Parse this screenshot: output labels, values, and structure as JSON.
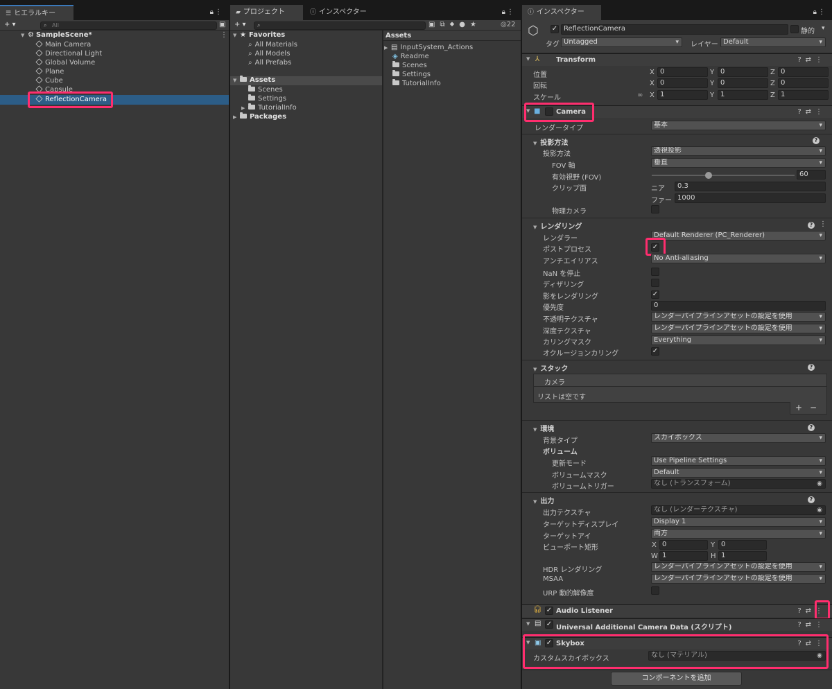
{
  "hierarchy": {
    "tab_label": "ヒエラルキー",
    "add_label": "+ ▾",
    "search_placeholder": "All",
    "scene": "SampleScene*",
    "items": [
      "Main Camera",
      "Directional Light",
      "Global Volume",
      "Plane",
      "Cube",
      "Capsule",
      "ReflectionCamera"
    ],
    "selected": "ReflectionCamera"
  },
  "project": {
    "tab_label": "プロジェクト",
    "inspector_tab_label": "インスペクター",
    "add_label": "+ ▾",
    "hidden_count": "22",
    "favorites_label": "Favorites",
    "favorites": [
      "All Materials",
      "All Models",
      "All Prefabs"
    ],
    "assets_label": "Assets",
    "assets_tree": [
      "Scenes",
      "Settings",
      "TutorialInfo"
    ],
    "packages_label": "Packages",
    "content_header": "Assets",
    "content_items": [
      "InputSystem_Actions",
      "Readme",
      "Scenes",
      "Settings",
      "TutorialInfo"
    ]
  },
  "inspector": {
    "tab_label": "インスペクター",
    "object_name": "ReflectionCamera",
    "static_label": "静的",
    "tag_label": "タグ",
    "tag_value": "Untagged",
    "layer_label": "レイヤー",
    "layer_value": "Default",
    "transform": {
      "title": "Transform",
      "position_label": "位置",
      "rotation_label": "回転",
      "scale_label": "スケール",
      "position": [
        "0",
        "0",
        "0"
      ],
      "rotation": [
        "0",
        "0",
        "0"
      ],
      "scale": [
        "1",
        "1",
        "1"
      ],
      "axis_x": "X",
      "axis_y": "Y",
      "axis_z": "Z"
    },
    "camera": {
      "title": "Camera",
      "render_type_label": "レンダータイプ",
      "render_type": "基本",
      "projection_header": "投影方法",
      "projection_label": "投影方法",
      "projection": "透視投影",
      "fov_axis_label": "FOV 軸",
      "fov_axis": "垂直",
      "fov_label": "有効視野 (FOV)",
      "fov": "60",
      "fov_fraction": 0.4,
      "clip_label": "クリップ面",
      "near_label": "ニア",
      "near": "0.3",
      "far_label": "ファー",
      "far": "1000",
      "physical_label": "物理カメラ",
      "rendering_header": "レンダリング",
      "renderer_label": "レンダラー",
      "renderer": "Default Renderer (PC_Renderer)",
      "post_label": "ポストプロセス",
      "aa_label": "アンチエイリアス",
      "aa": "No Anti-aliasing",
      "nan_label": "NaN を停止",
      "dither_label": "ディザリング",
      "shadows_label": "影をレンダリング",
      "priority_label": "優先度",
      "priority": "0",
      "opaque_label": "不透明テクスチャ",
      "opaque": "レンダーパイプラインアセットの設定を使用",
      "depth_label": "深度テクスチャ",
      "depth": "レンダーパイプラインアセットの設定を使用",
      "culling_label": "カリングマスク",
      "culling": "Everything",
      "occlusion_label": "オクルージョンカリング",
      "stack_header": "スタック",
      "stack_camera": "カメラ",
      "stack_empty": "リストは空です",
      "stack_add": "+",
      "stack_remove": "−",
      "env_header": "環境",
      "bg_type_label": "背景タイプ",
      "bg_type": "スカイボックス",
      "volume_header": "ボリューム",
      "update_mode_label": "更新モード",
      "update_mode": "Use Pipeline Settings",
      "volume_mask_label": "ボリュームマスク",
      "volume_mask": "Default",
      "volume_trigger_label": "ボリュームトリガー",
      "volume_trigger": "なし (トランスフォーム)",
      "output_header": "出力",
      "output_tex_label": "出力テクスチャ",
      "output_tex": "なし (レンダーテクスチャ)",
      "target_display_label": "ターゲットディスプレイ",
      "target_display": "Display 1",
      "target_eye_label": "ターゲットアイ",
      "target_eye": "両方",
      "viewport_label": "ビューポート矩形",
      "viewport_x": "0",
      "viewport_y": "0",
      "viewport_w": "1",
      "viewport_h": "1",
      "axis_w": "W",
      "axis_h": "H",
      "hdr_label": "HDR レンダリング",
      "hdr": "レンダーパイプラインアセットの設定を使用",
      "msaa_label": "MSAA",
      "msaa": "レンダーパイプラインアセットの設定を使用",
      "dyn_res_label": "URP 動的解像度"
    },
    "audio_listener": "Audio Listener",
    "additional_data": "Universal Additional Camera Data (スクリプト)",
    "skybox": {
      "title": "Skybox",
      "custom_label": "カスタムスカイボックス",
      "custom_value": "なし (マテリアル)"
    },
    "add_component": "コンポーネントを追加"
  },
  "colors": {
    "highlight": "#ff2d6e",
    "selection": "#2c5d87",
    "panel": "#383838"
  }
}
